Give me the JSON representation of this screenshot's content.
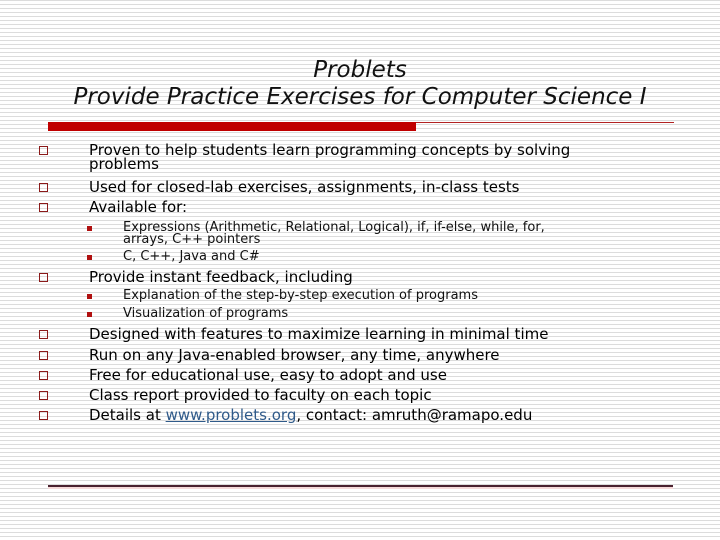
{
  "slide": {
    "title_lines": [
      "Problets",
      "Provide Practice Exercises for Computer Science I"
    ],
    "colors": {
      "accent_bar": "#c00000",
      "bullet_outline": "#8b1a1a",
      "sub_bullet": "#b01010",
      "link": "#2f5a8a",
      "background_stripe": "#dcdcdc"
    },
    "bullets": [
      {
        "level": 1,
        "marker": "hollow-square-bullet",
        "lines": [
          "Proven to help students learn programming concepts by solving",
          "problems"
        ]
      },
      {
        "level": 1,
        "marker": "hollow-square-bullet",
        "lines": [
          "Used for closed-lab exercises, assignments, in-class tests"
        ]
      },
      {
        "level": 1,
        "marker": "hollow-square-bullet",
        "lines": [
          "Available for:"
        ]
      },
      {
        "level": 2,
        "marker": "filled-square-bullet",
        "lines": [
          "Expressions (Arithmetic, Relational, Logical), if, if-else, while, for,",
          "arrays, C++ pointers"
        ]
      },
      {
        "level": 2,
        "marker": "filled-square-bullet",
        "lines": [
          "C, C++, Java and C#"
        ]
      },
      {
        "level": 1,
        "marker": "hollow-square-bullet",
        "lines": [
          "Provide instant feedback, including"
        ]
      },
      {
        "level": 2,
        "marker": "filled-square-bullet",
        "lines": [
          "Explanation of the step-by-step execution of programs"
        ]
      },
      {
        "level": 2,
        "marker": "filled-square-bullet",
        "lines": [
          "Visualization of programs"
        ]
      },
      {
        "level": 1,
        "marker": "hollow-square-bullet",
        "lines": [
          "Designed with features to maximize learning in minimal time"
        ]
      },
      {
        "level": 1,
        "marker": "hollow-square-bullet",
        "lines": [
          "Run on any Java-enabled browser, any time, anywhere"
        ]
      },
      {
        "level": 1,
        "marker": "hollow-square-bullet",
        "lines": [
          "Free for educational use, easy to adopt and use"
        ]
      },
      {
        "level": 1,
        "marker": "hollow-square-bullet",
        "lines": [
          "Class report provided to faculty on each topic"
        ]
      },
      {
        "level": 1,
        "marker": "hollow-square-bullet",
        "details": {
          "prefix": "Details at ",
          "link_text": "www.problets.org",
          "suffix": ", contact: amruth@ramapo.edu"
        }
      }
    ]
  }
}
